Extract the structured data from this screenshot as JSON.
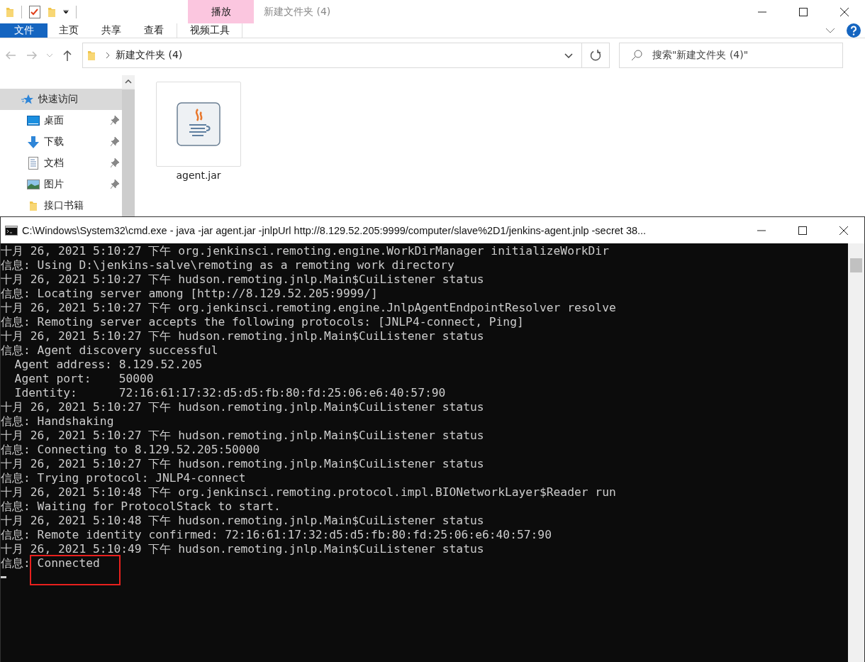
{
  "explorer": {
    "title": "新建文件夹 (4)",
    "context_tab": "播放",
    "ribbon_tabs": [
      {
        "label": "文件",
        "kind": "menu"
      },
      {
        "label": "主页",
        "kind": "tab"
      },
      {
        "label": "共享",
        "kind": "tab"
      },
      {
        "label": "查看",
        "kind": "tab"
      },
      {
        "label": "视频工具",
        "kind": "context"
      }
    ],
    "breadcrumb": "新建文件夹 (4)",
    "search": {
      "placeholder": "搜索\"新建文件夹 (4)\""
    },
    "nav_items": [
      {
        "label": "快速访问",
        "kind": "star",
        "selected": true,
        "pinned": false
      },
      {
        "label": "桌面",
        "kind": "desktop",
        "selected": false,
        "pinned": true
      },
      {
        "label": "下载",
        "kind": "download",
        "selected": false,
        "pinned": true
      },
      {
        "label": "文档",
        "kind": "document",
        "selected": false,
        "pinned": true
      },
      {
        "label": "图片",
        "kind": "pictures",
        "selected": false,
        "pinned": true
      },
      {
        "label": "接口书籍",
        "kind": "folder",
        "selected": false,
        "pinned": false
      }
    ],
    "files": [
      {
        "name": "agent.jar",
        "kind": "java"
      }
    ]
  },
  "console": {
    "title": "C:\\Windows\\System32\\cmd.exe - java  -jar agent.jar -jnlpUrl http://8.129.52.205:9999/computer/slave%2D1/jenkins-agent.jnlp -secret 38...",
    "lines": [
      {
        "text": "十月 26, 2021 5:10:27 下午 org.jenkinsci.remoting.engine.WorkDirManager initializeWorkDir",
        "highlighted": false
      },
      {
        "text": "信息: Using D:\\jenkins-salve\\remoting as a remoting work directory",
        "highlighted": false
      },
      {
        "text": "十月 26, 2021 5:10:27 下午 hudson.remoting.jnlp.Main$CuiListener status",
        "highlighted": false
      },
      {
        "text": "信息: Locating server among [http://8.129.52.205:9999/]",
        "highlighted": false
      },
      {
        "text": "十月 26, 2021 5:10:27 下午 org.jenkinsci.remoting.engine.JnlpAgentEndpointResolver resolve",
        "highlighted": false
      },
      {
        "text": "信息: Remoting server accepts the following protocols: [JNLP4-connect, Ping]",
        "highlighted": false
      },
      {
        "text": "十月 26, 2021 5:10:27 下午 hudson.remoting.jnlp.Main$CuiListener status",
        "highlighted": false
      },
      {
        "text": "信息: Agent discovery successful",
        "highlighted": false
      },
      {
        "text": "  Agent address: 8.129.52.205",
        "highlighted": false
      },
      {
        "text": "  Agent port:    50000",
        "highlighted": false
      },
      {
        "text": "  Identity:      72:16:61:17:32:d5:d5:fb:80:fd:25:06:e6:40:57:90",
        "highlighted": false
      },
      {
        "text": "十月 26, 2021 5:10:27 下午 hudson.remoting.jnlp.Main$CuiListener status",
        "highlighted": false
      },
      {
        "text": "信息: Handshaking",
        "highlighted": false
      },
      {
        "text": "十月 26, 2021 5:10:27 下午 hudson.remoting.jnlp.Main$CuiListener status",
        "highlighted": false
      },
      {
        "text": "信息: Connecting to 8.129.52.205:50000",
        "highlighted": false
      },
      {
        "text": "十月 26, 2021 5:10:27 下午 hudson.remoting.jnlp.Main$CuiListener status",
        "highlighted": false
      },
      {
        "text": "信息: Trying protocol: JNLP4-connect",
        "highlighted": false
      },
      {
        "text": "十月 26, 2021 5:10:48 下午 org.jenkinsci.remoting.protocol.impl.BIONetworkLayer$Reader run",
        "highlighted": false
      },
      {
        "text": "信息: Waiting for ProtocolStack to start.",
        "highlighted": false
      },
      {
        "text": "十月 26, 2021 5:10:48 下午 hudson.remoting.jnlp.Main$CuiListener status",
        "highlighted": false
      },
      {
        "text": "信息: Remote identity confirmed: 72:16:61:17:32:d5:d5:fb:80:fd:25:06:e6:40:57:90",
        "highlighted": false
      },
      {
        "text": "十月 26, 2021 5:10:49 下午 hudson.remoting.jnlp.Main$CuiListener status",
        "highlighted": false
      },
      {
        "prefix": "信息: ",
        "text": "Connected",
        "highlighted": true
      }
    ]
  }
}
